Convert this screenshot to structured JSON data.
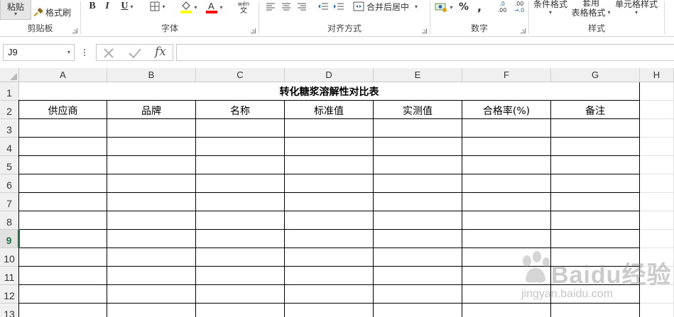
{
  "ribbon": {
    "clipboard": {
      "paste_label": "粘贴",
      "format_painter_label": "格式刷",
      "group_label": "剪贴板"
    },
    "font": {
      "bold": "B",
      "italic": "I",
      "underline": "U",
      "phonetic_top": "wén",
      "phonetic_bottom": "文",
      "group_label": "字体",
      "fill_color": "#ffff00",
      "font_color": "#ff0000"
    },
    "alignment": {
      "merge_label": "合并后居中",
      "group_label": "对齐方式"
    },
    "number": {
      "percent": "%",
      "comma": ",",
      "inc_decimal_top": ".0",
      "inc_decimal_bottom": ".00",
      "dec_decimal_top": ".00",
      "dec_decimal_bottom": "→.0",
      "group_label": "数字"
    },
    "styles": {
      "conditional_format": "条件格式",
      "table_format_top": "套用",
      "table_format_bottom": "表格格式",
      "cell_styles": "单元格样式",
      "group_label": "样式"
    }
  },
  "formula_bar": {
    "name_box": "J9",
    "fx": "fx",
    "formula": ""
  },
  "columns": [
    "A",
    "B",
    "C",
    "D",
    "E",
    "F",
    "G",
    "H"
  ],
  "rows": [
    "1",
    "2",
    "3",
    "4",
    "5",
    "6",
    "7",
    "8",
    "9",
    "10",
    "11",
    "12",
    "13"
  ],
  "sheet": {
    "title": "转化糖浆溶解性对比表",
    "headers": [
      "供应商",
      "品牌",
      "名称",
      "标准值",
      "实测值",
      "合格率(%)",
      "备注"
    ]
  },
  "active_row": "9",
  "watermark": {
    "text": "Baidu经验",
    "sub": "jingyan.baidu.com"
  },
  "colors": {
    "accent": "#217346",
    "header_bg": "#f0f0f0"
  }
}
